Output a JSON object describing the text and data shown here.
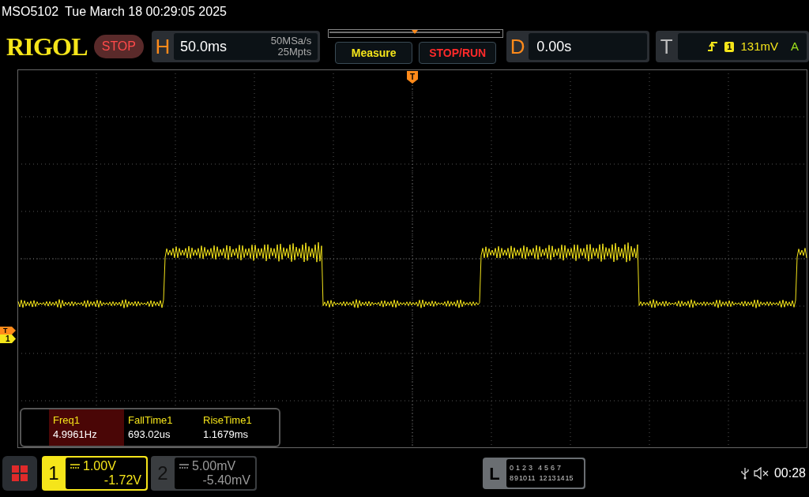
{
  "title_bar": {
    "model": "MSO5102",
    "datetime": "Tue March 18 00:29:05 2025"
  },
  "toolbar": {
    "logo": "RIGOL",
    "run_state": "STOP",
    "horizontal": {
      "label": "H",
      "timebase": "50.0ms",
      "sample_rate": "50MSa/s",
      "memory_depth": "25Mpts"
    },
    "measure_button": "Measure",
    "stop_run_button": "STOP/RUN",
    "delay": {
      "label": "D",
      "value": "0.00s"
    },
    "trigger": {
      "label": "T",
      "source": "1",
      "level": "131mV",
      "mode": "A"
    }
  },
  "screen": {
    "trigger_position_marker": "T",
    "trigger_level_marker": "T",
    "channel_marker": "1"
  },
  "measurements": [
    {
      "name": "Freq1",
      "value": "4.9961Hz",
      "selected": true
    },
    {
      "name": "FallTime1",
      "value": "693.02us",
      "selected": false
    },
    {
      "name": "RiseTime1",
      "value": "1.1679ms",
      "selected": false
    }
  ],
  "channels": [
    {
      "number": "1",
      "scale": "1.00V",
      "offset": "-1.72V",
      "active": true
    },
    {
      "number": "2",
      "scale": "5.00mV",
      "offset": "-5.40mV",
      "active": false
    }
  ],
  "logic": {
    "label": "L",
    "row_1": [
      "0",
      "1",
      "2",
      "3",
      "4",
      "5",
      "6",
      "7"
    ],
    "row_2": [
      "8",
      "9",
      "10",
      "11",
      "12",
      "13",
      "14",
      "15"
    ]
  },
  "status": {
    "time": "00:28"
  }
}
